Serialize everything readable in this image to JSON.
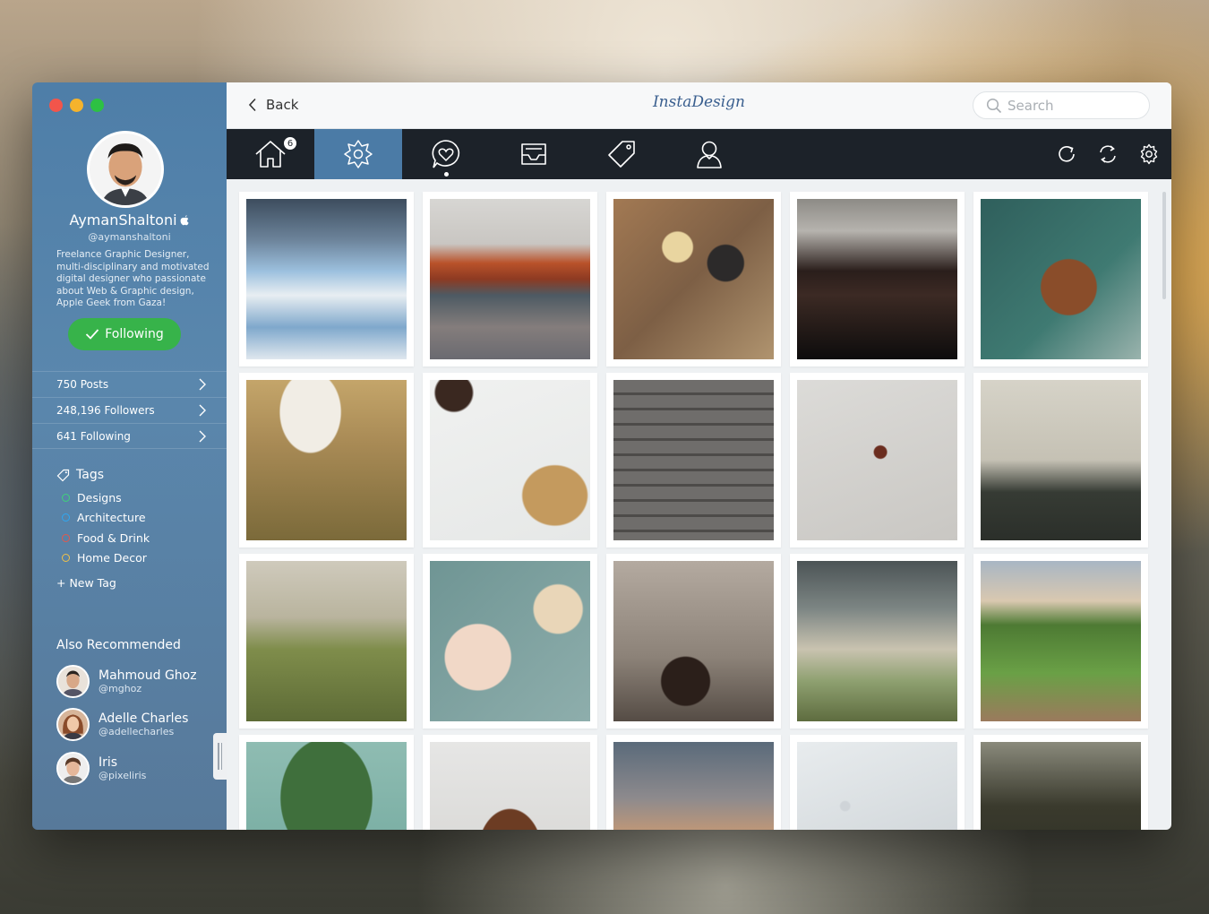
{
  "window": {
    "traffic_lights": [
      "close",
      "minimize",
      "zoom"
    ]
  },
  "colors": {
    "sidebar": "#5483ab",
    "accent": "#4b7ba6",
    "toolbar": "#1c2229",
    "follow": "#37b34a"
  },
  "profile": {
    "name": "AymanShaltoni",
    "handle": "@aymanshaltoni",
    "bio": "Freelance Graphic Designer, multi-disciplinary and motivated digital designer who passionate about Web & Graphic design, Apple Geek  from Gaza!",
    "follow_label": "Following"
  },
  "stats": [
    {
      "label": "750 Posts"
    },
    {
      "label": "248,196 Followers"
    },
    {
      "label": "641 Following"
    }
  ],
  "tags": {
    "title": "Tags",
    "items": [
      {
        "label": "Designs",
        "color": "#3fd27a"
      },
      {
        "label": "Architecture",
        "color": "#2ea7f2"
      },
      {
        "label": "Food & Drink",
        "color": "#e3584b"
      },
      {
        "label": "Home Decor",
        "color": "#f2c14a"
      }
    ],
    "new_tag": "+ New Tag"
  },
  "recommended": {
    "title": "Also Recommended",
    "users": [
      {
        "name": "Mahmoud Ghoz",
        "handle": "@mghoz"
      },
      {
        "name": "Adelle Charles",
        "handle": "@adellecharles"
      },
      {
        "name": "Iris",
        "handle": "@pixeliris"
      }
    ]
  },
  "titlebar": {
    "back_label": "Back",
    "logo": "InstaDesign",
    "search_placeholder": "Search"
  },
  "toolbar": {
    "home_badge": "6",
    "tabs": [
      "home-icon",
      "explore-icon",
      "activity-icon",
      "inbox-icon",
      "tag-icon",
      "profile-icon"
    ],
    "active_tab": "explore-icon",
    "right_icons": [
      "refresh-icon",
      "sync-icon",
      "settings-icon"
    ]
  },
  "grid": {
    "photos": [
      "reflection-sky",
      "autumn-lake",
      "flatlay-helmet",
      "cafe-tables",
      "picnic-table",
      "vintage-car",
      "snack-board",
      "shoes-deck",
      "wall-wine",
      "city-crowd",
      "old-tractor",
      "breakfast-plate",
      "hair-splash",
      "storm-motorbikes",
      "dirt-road",
      "plant-head",
      "dog-googly-eyes",
      "sunset-car",
      "rain-window",
      "dark-trees"
    ]
  }
}
